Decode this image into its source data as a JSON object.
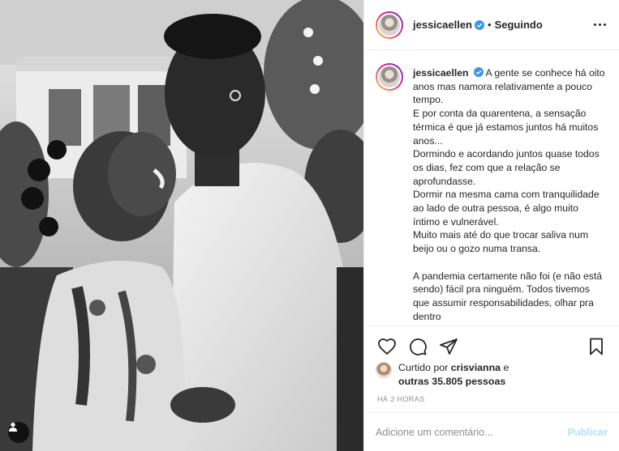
{
  "post": {
    "username": "jessicaellen",
    "following_label": "Seguindo",
    "separator": "•",
    "caption_lines": [
      "A gente se conhece há oito anos mas namora relativamente a pouco tempo.",
      "E por conta da quarentena, a sensação térmica é que já estamos juntos há muitos anos...",
      "Dormindo e acordando juntos quase todos os dias, fez com que a relação se aprofundasse.",
      "Dormir na mesma cama com tranquilidade ao lado de outra pessoa, é algo muito íntimo e vulnerável.",
      "Muito mais até do que trocar saliva num beijo ou o gozo numa transa.",
      "",
      "A pandemia certamente não foi (e não está sendo) fácil pra ninguém. Todos tivemos que assumir responsabilidades, olhar pra dentro"
    ],
    "likes": {
      "prefix": "Curtido por",
      "liker": "crisvianna",
      "connector": "e",
      "others": "outras 35.805 pessoas"
    },
    "timestamp": "HÁ 2 HORAS",
    "comment_placeholder": "Adicione um comentário...",
    "publish_label": "Publicar"
  },
  "icons": {
    "verified": "verified-badge-icon",
    "more": "more-options-icon",
    "like": "heart-icon",
    "comment": "comment-icon",
    "share": "paper-plane-icon",
    "save": "bookmark-icon",
    "tag": "user-tag-icon"
  },
  "colors": {
    "verified_blue": "#3897f0",
    "publish_disabled": "#b2dffc",
    "muted_text": "#8e8e8e"
  }
}
